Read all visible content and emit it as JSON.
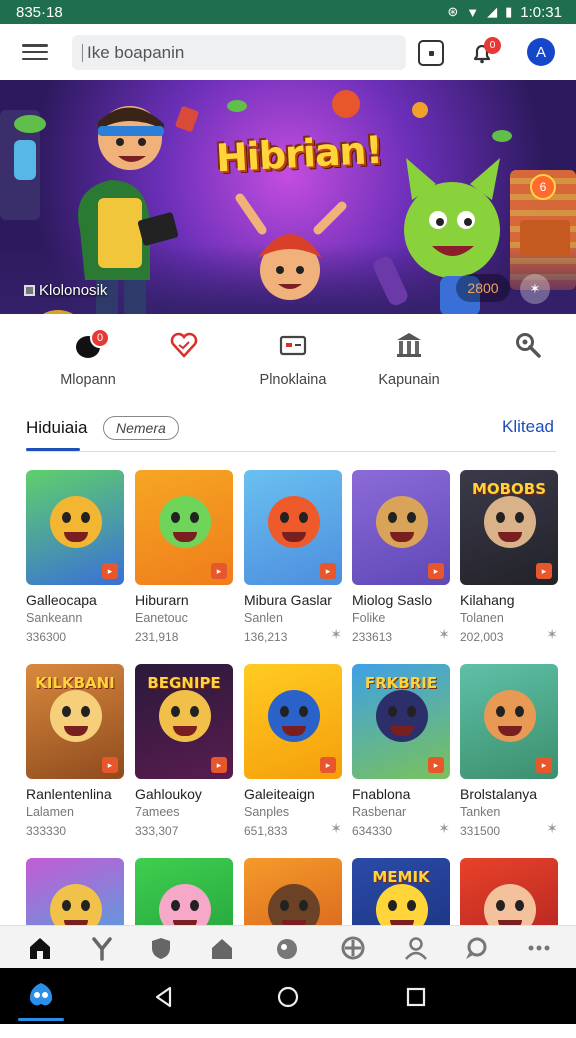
{
  "status_bar": {
    "time": "835·18",
    "right_time": "1:0:31"
  },
  "search": {
    "placeholder": "Ike boapanin"
  },
  "notifications": {
    "badge": "0"
  },
  "profile": {
    "initial": "A"
  },
  "hero": {
    "title": "Hibrian!",
    "caption": "Klolonosik",
    "pill": "2800",
    "balloon": "6"
  },
  "categories": [
    {
      "label": "Mlopann",
      "badge": "0"
    },
    {
      "label": ""
    },
    {
      "label": "Plnoklaina"
    },
    {
      "label": "Kapunain"
    },
    {
      "label": ""
    }
  ],
  "section": {
    "title": "Hiduiaia",
    "chip": "Nemera",
    "link": "Klitead"
  },
  "games": [
    {
      "name": "Galleocapa",
      "sub": "Sankeann",
      "num": "336300",
      "thumb_title": ""
    },
    {
      "name": "Hiburarn",
      "sub": "Eanetouc",
      "num": "231,918",
      "thumb_title": ""
    },
    {
      "name": "Mibura Gaslar",
      "sub": "Sanlen",
      "num": "136,213",
      "thumb_title": ""
    },
    {
      "name": "Miolog Saslo",
      "sub": "Folike",
      "num": "233613",
      "thumb_title": ""
    },
    {
      "name": "Kilahang",
      "sub": "Tolanen",
      "num": "202,003",
      "thumb_title": "MOBOBS"
    },
    {
      "name": "Ranlentenlina",
      "sub": "Lalamen",
      "num": "333330",
      "thumb_title": "KILKBANI"
    },
    {
      "name": "Gahloukoy",
      "sub": "7amees",
      "num": "333,307",
      "thumb_title": "BEGNIPE"
    },
    {
      "name": "Galeiteaign",
      "sub": "Sanples",
      "num": "651,833",
      "thumb_title": ""
    },
    {
      "name": "Fnablona",
      "sub": "Rasbenar",
      "num": "634330",
      "thumb_title": "FRKBRIE"
    },
    {
      "name": "Brolstalanya",
      "sub": "Tanken",
      "num": "331500",
      "thumb_title": ""
    },
    {
      "name": "",
      "sub": "",
      "num": "",
      "thumb_title": ""
    },
    {
      "name": "",
      "sub": "",
      "num": "",
      "thumb_title": ""
    },
    {
      "name": "",
      "sub": "",
      "num": "",
      "thumb_title": ""
    },
    {
      "name": "",
      "sub": "",
      "num": "",
      "thumb_title": "MEMIK"
    },
    {
      "name": "",
      "sub": "",
      "num": "",
      "thumb_title": ""
    }
  ],
  "thumb_colors": [
    [
      "#5fd06a",
      "#3a6fd8",
      "#f2b632"
    ],
    [
      "#f6a623",
      "#ef7d1b",
      "#6fd45a"
    ],
    [
      "#6ac0f0",
      "#4c8ede",
      "#ef5a2a"
    ],
    [
      "#8c6bd8",
      "#5d48b6",
      "#d9a45a"
    ],
    [
      "#3b3a4a",
      "#222229",
      "#d9b28a"
    ],
    [
      "#d98a3e",
      "#8f4a1e",
      "#f5cf7a"
    ],
    [
      "#2a1a3a",
      "#591c4f",
      "#f0c04a"
    ],
    [
      "#ffcc22",
      "#f59e0b",
      "#2b62c9"
    ],
    [
      "#3fa0e6",
      "#79c25a",
      "#2d2f6a"
    ],
    [
      "#5fc0a8",
      "#3b8f6c",
      "#e89a55"
    ],
    [
      "#c45cd4",
      "#3ab0e0",
      "#f0c24a"
    ],
    [
      "#3fcf4f",
      "#1f9a3a",
      "#f5a8c8"
    ],
    [
      "#f59b2a",
      "#d2581c",
      "#6b4226"
    ],
    [
      "#2a4ba8",
      "#1a2f78",
      "#ffd53a"
    ],
    [
      "#e8422a",
      "#a81f1f",
      "#f3c19b"
    ]
  ]
}
